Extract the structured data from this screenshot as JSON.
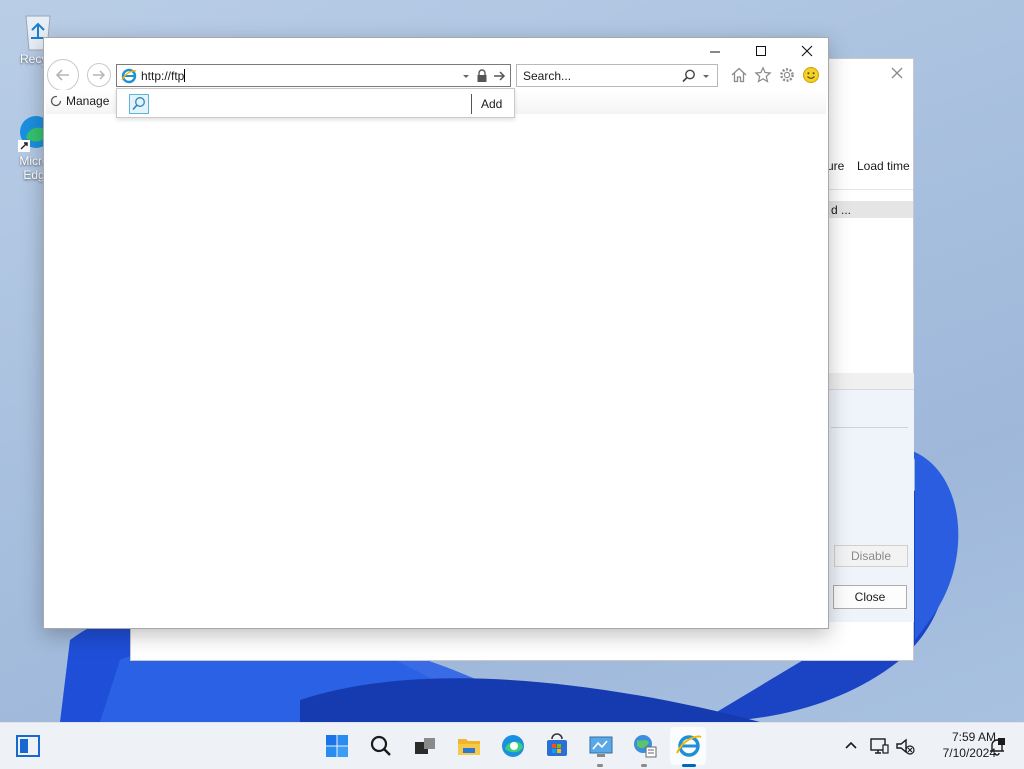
{
  "desktop": {
    "icons": [
      {
        "label": "Recycl",
        "icon": "recycle-bin-icon"
      },
      {
        "label": "Micro\nEdg",
        "icon": "edge-icon"
      }
    ]
  },
  "background_dialog": {
    "columns": [
      "ure",
      "Load time"
    ],
    "row_text": "d ...",
    "buttons": {
      "disable": "Disable",
      "close": "Close"
    }
  },
  "ie_window": {
    "address_value": "http://ftp",
    "search_placeholder": "Search...",
    "tab_label": "Manage",
    "suggestion_add": "Add",
    "window_controls": [
      "minimize-icon",
      "maximize-icon",
      "close-icon"
    ],
    "toolbar_icons": [
      "home-icon",
      "favorites-star-icon",
      "settings-gear-icon",
      "smiley-feedback-icon"
    ]
  },
  "taskbar": {
    "apps": [
      "windows-start-icon",
      "search-icon",
      "task-view-icon",
      "file-explorer-icon",
      "edge-icon",
      "store-icon",
      "control-panel-icon",
      "network-globe-icon",
      "internet-explorer-icon"
    ],
    "tray": {
      "time": "7:59 AM",
      "date": "7/10/2024"
    }
  },
  "colors": {
    "accent": "#0067c0",
    "ie_blue": "#1e90d6",
    "bloom": "#1f4fd8"
  }
}
